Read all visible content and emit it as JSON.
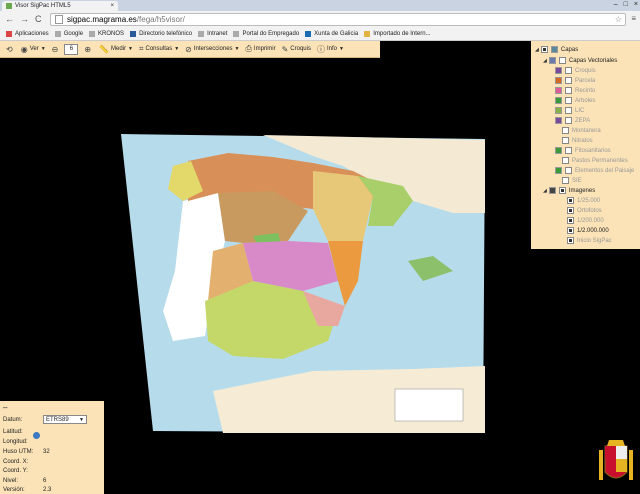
{
  "browser": {
    "tab_title": "Visor SigPac HTML5",
    "tab_close": "×",
    "window_controls": [
      "–",
      "□",
      "×"
    ],
    "nav": {
      "back": "←",
      "forward": "→",
      "reload": "C"
    },
    "url_domain": "sigpac.magrama.es",
    "url_path": "/fega/h5visor/",
    "star": "☆",
    "menu": "≡",
    "bookmarks": [
      {
        "label": "Aplicaciones",
        "icon": "apps-icon",
        "color": "#d44"
      },
      {
        "label": "Google",
        "icon": "page-icon",
        "color": "#aaa"
      },
      {
        "label": "KRONOS",
        "icon": "page-icon",
        "color": "#aaa"
      },
      {
        "label": "Directorio telefónico",
        "icon": "app-icon",
        "color": "#2a5a9a"
      },
      {
        "label": "Intranet",
        "icon": "page-icon",
        "color": "#aaa"
      },
      {
        "label": "Portal do Empregado",
        "icon": "page-icon",
        "color": "#aaa"
      },
      {
        "label": "Xunta de Galicia",
        "icon": "xunta-icon",
        "color": "#1c6cb4"
      },
      {
        "label": "Importado de Intern...",
        "icon": "folder-icon",
        "color": "#e3b341"
      }
    ]
  },
  "toolbar": {
    "ver": "Ver",
    "zoom_level": "6",
    "medir": "Medir",
    "consultas": "Consultas",
    "intersecciones": "Intersecciones",
    "imprimir": "Imprimir",
    "croquis": "Croquis",
    "info": "Info"
  },
  "layers": {
    "root": "Capas",
    "vector_group": "Capas Vectoriales",
    "vector_items": [
      {
        "label": "Croquis",
        "swatch": "#7a4a9a",
        "checked": false
      },
      {
        "label": "Parcela",
        "swatch": "#d46a20",
        "checked": false
      },
      {
        "label": "Recinto",
        "swatch": "#e05a9a",
        "checked": false
      },
      {
        "label": "Arboles",
        "swatch": "#3a9a3a",
        "checked": false
      },
      {
        "label": "LIC",
        "swatch": "#8ab04a",
        "checked": false
      },
      {
        "label": "ZEPA",
        "swatch": "#7a4a9a",
        "checked": false
      },
      {
        "label": "Montanera",
        "swatch": "",
        "checked": false
      },
      {
        "label": "Nitratos",
        "swatch": "",
        "checked": false
      },
      {
        "label": "Fitosanitarios",
        "swatch": "#3a9a3a",
        "checked": false
      },
      {
        "label": "Pastos Permanentes",
        "swatch": "",
        "checked": false
      },
      {
        "label": "Elementos del Paisaje",
        "swatch": "#3a9a3a",
        "checked": false
      },
      {
        "label": "SIE",
        "swatch": "",
        "checked": false
      }
    ],
    "image_group": "Imagenes",
    "image_items": [
      {
        "label": "1/25.000",
        "checked": true,
        "active": false
      },
      {
        "label": "Ortofotos",
        "checked": true,
        "active": false
      },
      {
        "label": "1/200.000",
        "checked": true,
        "active": false
      },
      {
        "label": "1/2.000.000",
        "checked": true,
        "active": true
      },
      {
        "label": "Inicio SigPac",
        "checked": true,
        "active": false
      }
    ]
  },
  "coords": {
    "collapse": "–",
    "datum_label": "Datum:",
    "datum_value": "ETRS89",
    "latitud_label": "Latitud:",
    "longitud_label": "Longitud:",
    "huso_label": "Huso UTM:",
    "huso_value": "32",
    "coordx_label": "Coord. X:",
    "coordy_label": "Coord. Y:",
    "nivel_label": "Nivel:",
    "nivel_value": "6",
    "version_label": "Versión:",
    "version_value": "2.3"
  },
  "colors": {
    "panel": "#fbe3b7",
    "sea": "#b6dcec",
    "portugal": "#ffffff",
    "france": "#f5ecd8"
  }
}
